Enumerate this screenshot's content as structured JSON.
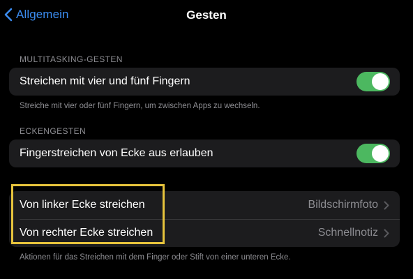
{
  "nav": {
    "back_label": "Allgemein",
    "title": "Gesten"
  },
  "multitasking": {
    "header": "MULTITASKING-GESTEN",
    "row_label": "Streichen mit vier und fünf Fingern",
    "toggle_on": true,
    "footer": "Streiche mit vier oder fünf Fingern, um zwischen Apps zu wechseln."
  },
  "corner": {
    "header": "ECKENGESTEN",
    "row_label": "Fingerstreichen von Ecke aus erlauben",
    "toggle_on": true
  },
  "corner_actions": {
    "rows": [
      {
        "label": "Von linker Ecke streichen",
        "value": "Bildschirmfoto"
      },
      {
        "label": "Von rechter Ecke streichen",
        "value": "Schnellnotiz"
      }
    ],
    "footer": "Aktionen für das Streichen mit dem Finger oder Stift von einer unteren Ecke."
  },
  "colors": {
    "accent": "#3b8cf0",
    "toggle_on": "#4cb860",
    "highlight": "#e6c33c",
    "group_bg": "#1c1c1e",
    "secondary_text": "#8d8d92"
  },
  "icons": {
    "back": "chevron-left-icon",
    "disclosure": "chevron-right-icon"
  }
}
